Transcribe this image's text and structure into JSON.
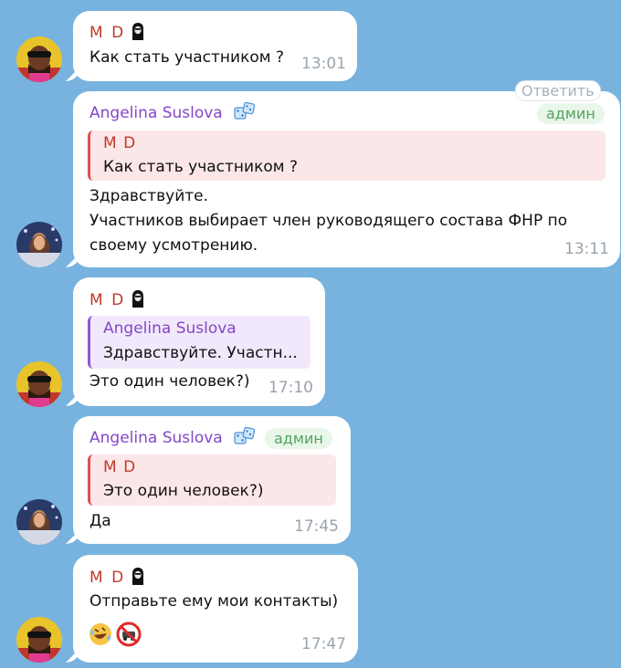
{
  "messages": {
    "m1": {
      "sender": "M D",
      "text": "Как стать участником ?",
      "time": "13:01"
    },
    "m2": {
      "sender": "Angelina Suslova",
      "reply_button": "Ответить",
      "badge": "админ",
      "quote_name": "M D",
      "quote_text": "Как стать участником ?",
      "line1": "Здравствуйте.",
      "line2": "Участников выбирает член руководящего состава ФНР по",
      "line3": "своему усмотрению.",
      "time": "13:11"
    },
    "m3": {
      "sender": "M D",
      "quote_name": "Angelina Suslova",
      "quote_text": "Здравствуйте. Участн...",
      "text": "Это один человек?)",
      "time": "17:10"
    },
    "m4": {
      "sender": "Angelina Suslova",
      "badge": "админ",
      "quote_name": "M D",
      "quote_text": "Это один человек?)",
      "text": "Да",
      "time": "17:45"
    },
    "m5": {
      "sender": "M D",
      "text": "Отправьте ему мои контакты)",
      "time": "17:47"
    }
  },
  "colors": {
    "background": "#77b3de",
    "md_name": "#c0392b",
    "admin_name": "#8547c8",
    "admin_badge": "#55a35d"
  },
  "icons": {
    "md_badge": "hooded-figure-icon",
    "as_badge": "dice-icon",
    "emoji1": "rolling-laughing-emoji-icon",
    "emoji2": "no-cars-emoji-icon"
  }
}
